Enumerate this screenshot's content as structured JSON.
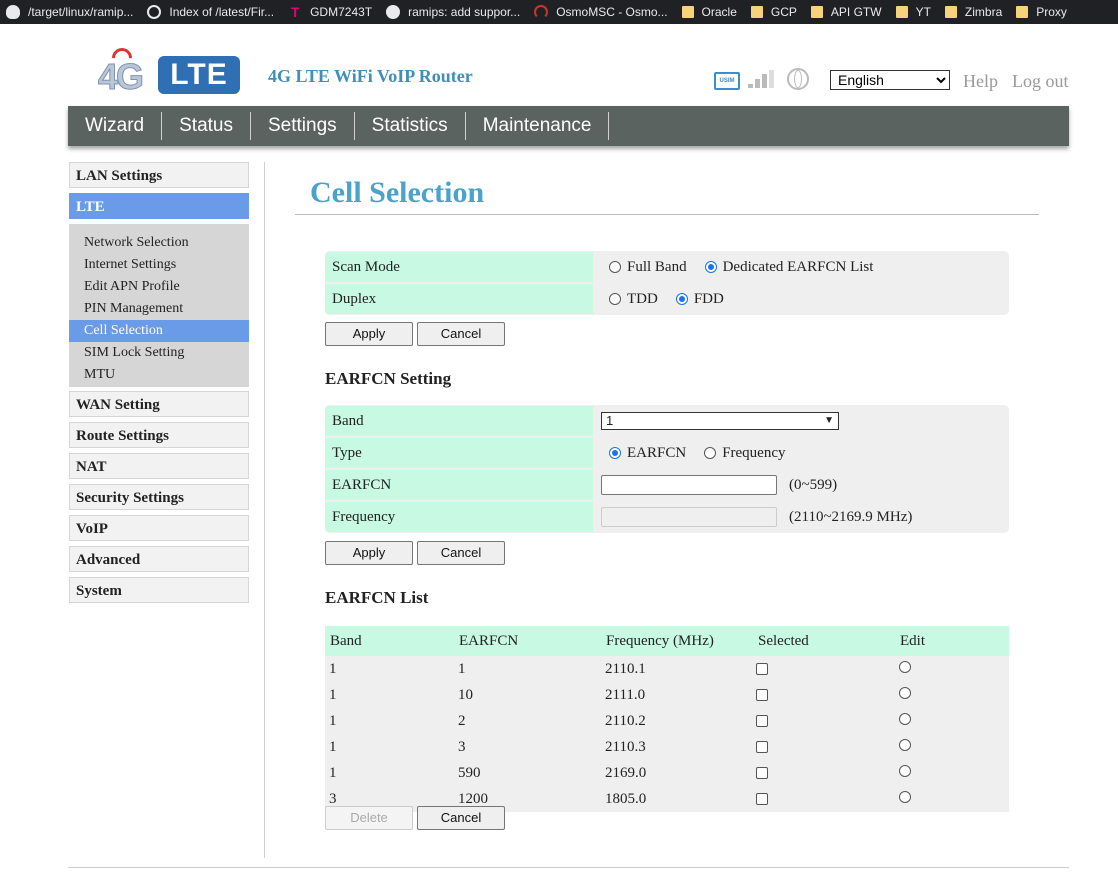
{
  "bookmarks": [
    {
      "label": "/target/linux/ramip...",
      "icon": "openwrt-icon"
    },
    {
      "label": "Index of /latest/Fir...",
      "icon": "globe-icon"
    },
    {
      "label": "GDM7243T",
      "icon": "tmobile-icon"
    },
    {
      "label": "ramips: add suppor...",
      "icon": "github-icon"
    },
    {
      "label": "OsmoMSC - Osmo...",
      "icon": "osmocom-icon"
    },
    {
      "label": "Oracle",
      "icon": "folder-icon"
    },
    {
      "label": "GCP",
      "icon": "folder-icon"
    },
    {
      "label": "API GTW",
      "icon": "folder-icon"
    },
    {
      "label": "YT",
      "icon": "folder-icon"
    },
    {
      "label": "Zimbra",
      "icon": "folder-icon"
    },
    {
      "label": "Proxy",
      "icon": "folder-icon"
    }
  ],
  "header": {
    "logo_4g": "4G",
    "logo_lte": "LTE",
    "product_name": "4G LTE WiFi VoIP Router",
    "usim_label": "USIM",
    "language": "English",
    "help": "Help",
    "logout": "Log out"
  },
  "nav": [
    "Wizard",
    "Status",
    "Settings",
    "Statistics",
    "Maintenance"
  ],
  "sidebar": {
    "top": [
      "LAN Settings",
      "LTE"
    ],
    "lte_sub": [
      "Network Selection",
      "Internet Settings",
      "Edit APN Profile",
      "PIN Management",
      "Cell Selection",
      "SIM Lock Setting",
      "MTU"
    ],
    "bottom": [
      "WAN Setting",
      "Route Settings",
      "NAT",
      "Security Settings",
      "VoIP",
      "Advanced",
      "System"
    ]
  },
  "page": {
    "title": "Cell Selection",
    "scan_mode_label": "Scan Mode",
    "scan_mode_options": [
      "Full Band",
      "Dedicated EARFCN List"
    ],
    "scan_mode_selected": "Dedicated EARFCN List",
    "duplex_label": "Duplex",
    "duplex_options": [
      "TDD",
      "FDD"
    ],
    "duplex_selected": "FDD",
    "apply": "Apply",
    "cancel": "Cancel",
    "delete": "Delete"
  },
  "earfcn_setting": {
    "heading": "EARFCN Setting",
    "band_label": "Band",
    "band_value": "1",
    "type_label": "Type",
    "type_options": [
      "EARFCN",
      "Frequency"
    ],
    "type_selected": "EARFCN",
    "earfcn_label": "EARFCN",
    "earfcn_value": "",
    "earfcn_range": "(0~599)",
    "frequency_label": "Frequency",
    "frequency_value": "",
    "frequency_range": "(2110~2169.9 MHz)"
  },
  "earfcn_list": {
    "heading": "EARFCN List",
    "columns": [
      "Band",
      "EARFCN",
      "Frequency (MHz)",
      "Selected",
      "Edit"
    ],
    "rows": [
      [
        "1",
        "1",
        "2110.1"
      ],
      [
        "1",
        "10",
        "2111.0"
      ],
      [
        "1",
        "2",
        "2110.2"
      ],
      [
        "1",
        "3",
        "2110.3"
      ],
      [
        "1",
        "590",
        "2169.0"
      ],
      [
        "3",
        "1200",
        "1805.0"
      ]
    ]
  }
}
